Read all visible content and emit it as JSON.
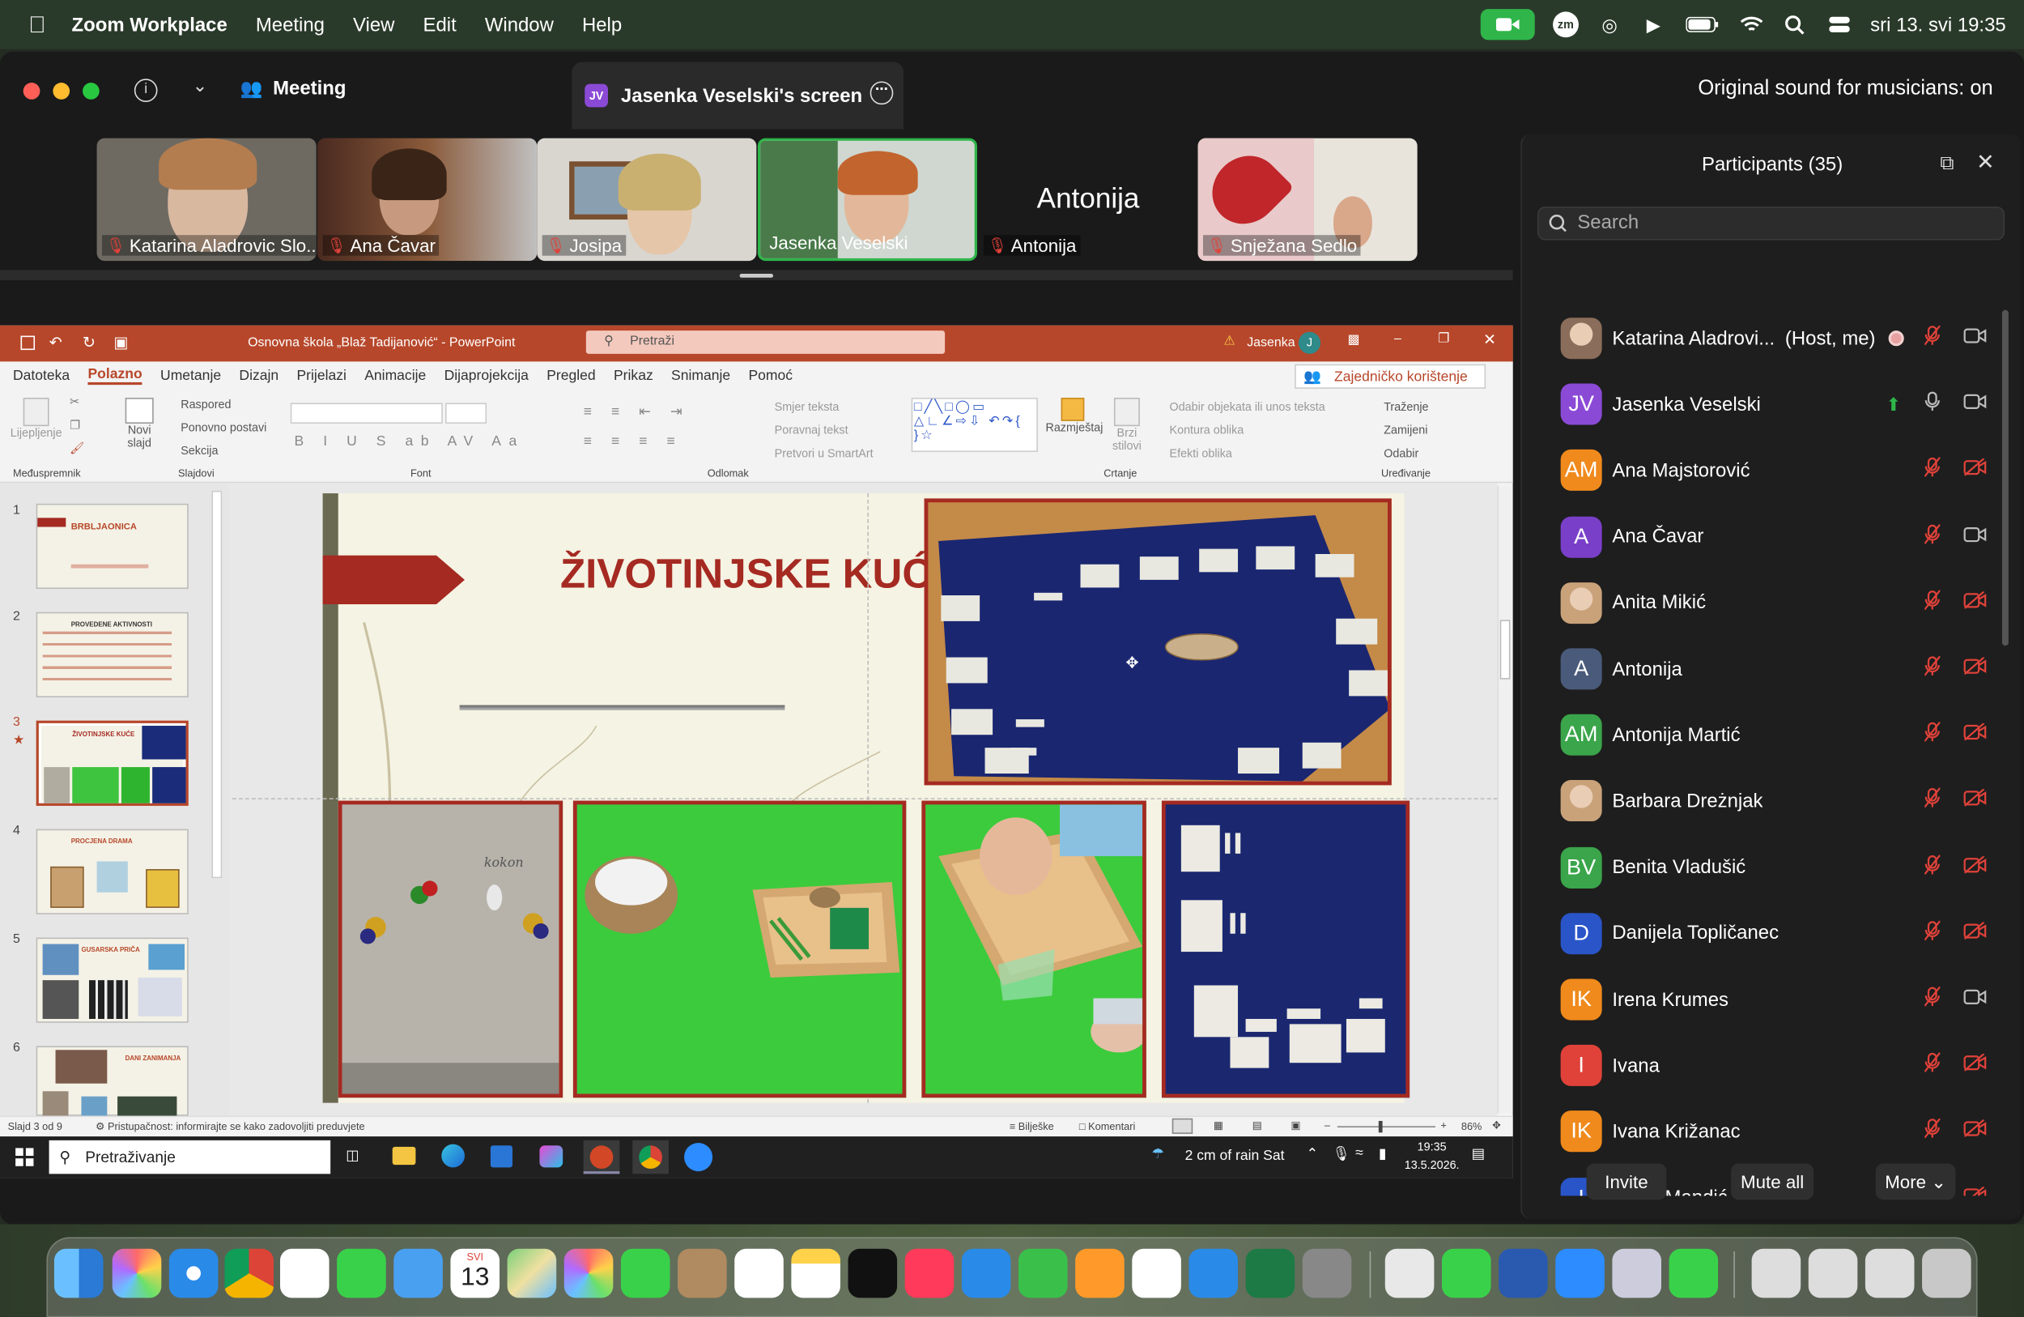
{
  "menubar": {
    "app": "Zoom Workplace",
    "items": [
      "Meeting",
      "View",
      "Edit",
      "Window",
      "Help"
    ],
    "clock": "sri 13. svi  19:35"
  },
  "zoom": {
    "meeting_label": "Meeting",
    "screen_tab": "Jasenka Veselski's screen",
    "screen_badge": "JV",
    "sound_status": "Original sound for musicians: on",
    "thumbnails": [
      "Katarina Aladrovic Slo...",
      "Ana Čavar",
      "Josipa",
      "Jasenka Veselski",
      "Antonija",
      "Snježana Sedlo"
    ],
    "thumb_big_name": "Antonija"
  },
  "participants": {
    "title": "Participants (35)",
    "search_placeholder": "Search",
    "rows": [
      {
        "initials": "",
        "name": "Katarina Aladrovi...",
        "extra": "(Host, me)",
        "color": "#8a6d5a"
      },
      {
        "initials": "JV",
        "name": "Jasenka Veselski",
        "extra": "",
        "color": "#8b4ad6"
      },
      {
        "initials": "AM",
        "name": "Ana Majstorović",
        "extra": "",
        "color": "#f08a1c"
      },
      {
        "initials": "A",
        "name": "Ana Čavar",
        "extra": "",
        "color": "#7a3fc9"
      },
      {
        "initials": "",
        "name": "Anita Mikić",
        "extra": "",
        "color": "#c9a27a"
      },
      {
        "initials": "A",
        "name": "Antonija",
        "extra": "",
        "color": "#4a5a7a"
      },
      {
        "initials": "AM",
        "name": "Antonija Martić",
        "extra": "",
        "color": "#3aa54a"
      },
      {
        "initials": "",
        "name": "Barbara Dreżnjak",
        "extra": "",
        "color": "#c9a27a"
      },
      {
        "initials": "BV",
        "name": "Benita Vladušić",
        "extra": "",
        "color": "#3aa54a"
      },
      {
        "initials": "D",
        "name": "Danijela Topličanec",
        "extra": "",
        "color": "#2a55c9"
      },
      {
        "initials": "IK",
        "name": "Irena Krumes",
        "extra": "",
        "color": "#f08a1c"
      },
      {
        "initials": "I",
        "name": "Ivana",
        "extra": "",
        "color": "#e0423a"
      },
      {
        "initials": "IK",
        "name": "Ivana Križanac",
        "extra": "",
        "color": "#f08a1c"
      },
      {
        "initials": "I",
        "name": "Ivana Mandić",
        "extra": "",
        "color": "#2a55c9"
      }
    ],
    "invite": "Invite",
    "mute_all": "Mute all",
    "more": "More"
  },
  "ppt": {
    "doc_title": "Osnovna škola „Blaž Tadijanović“ - PowerPoint",
    "search": "Pretraži",
    "user": "Jasenka",
    "user_initial": "J",
    "tabs": [
      "Datoteka",
      "Polazno",
      "Umetanje",
      "Dizajn",
      "Prijelazi",
      "Animacije",
      "Dijaprojekcija",
      "Pregled",
      "Prikaz",
      "Snimanje",
      "Pomoć"
    ],
    "share_button": "Zajedničko korištenje",
    "groups": [
      "Međuspremnik",
      "Slajdovi",
      "Font",
      "Odlomak",
      "Crtanje",
      "Uređivanje"
    ],
    "rib": {
      "paste": "Lijepljenje",
      "new_slide": "Novi slajd",
      "layout": "Raspored",
      "reset": "Ponovno postavi",
      "section": "Sekcija",
      "text_dir": "Smjer teksta",
      "align_text": "Poravnaj tekst",
      "smartart": "Pretvori u SmartArt",
      "arrange": "Razmještaj",
      "quick_styles": "Brzi stilovi",
      "select_obj": "Odabir objekata ili unos teksta",
      "outline": "Kontura oblika",
      "effects": "Efekti oblika",
      "find": "Traženje",
      "replace": "Zamijeni",
      "select": "Odabir"
    },
    "slide_title": "ŽIVOTINJSKE KUĆE",
    "thumbs": [
      {
        "num": "1",
        "title": "BRBLJAONICA"
      },
      {
        "num": "2",
        "title": "PROVEDENE AKTIVNOSTI"
      },
      {
        "num": "3",
        "title": "ŽIVOTINJSKE KUĆE"
      },
      {
        "num": "4",
        "title": "PROCJENA DRAMA"
      },
      {
        "num": "5",
        "title": "GUSARSKA PRIČA"
      },
      {
        "num": "6",
        "title": "DANI ZANIMANJA"
      }
    ],
    "status_slide": "Slajd 3 od 9",
    "status_access": "Pristupačnost: informirajte se kako zadovoljiti preduvjete",
    "notes": "Bilješke",
    "comments": "Komentari",
    "zoom_pct": "86%",
    "board_word": "kokon"
  },
  "taskbar": {
    "search": "Pretraživanje",
    "weather": "2 cm of rain Sat",
    "time": "19:35",
    "date": "13.5.2026."
  },
  "dock": {
    "calendar_month": "SVI",
    "calendar_day": "13"
  }
}
